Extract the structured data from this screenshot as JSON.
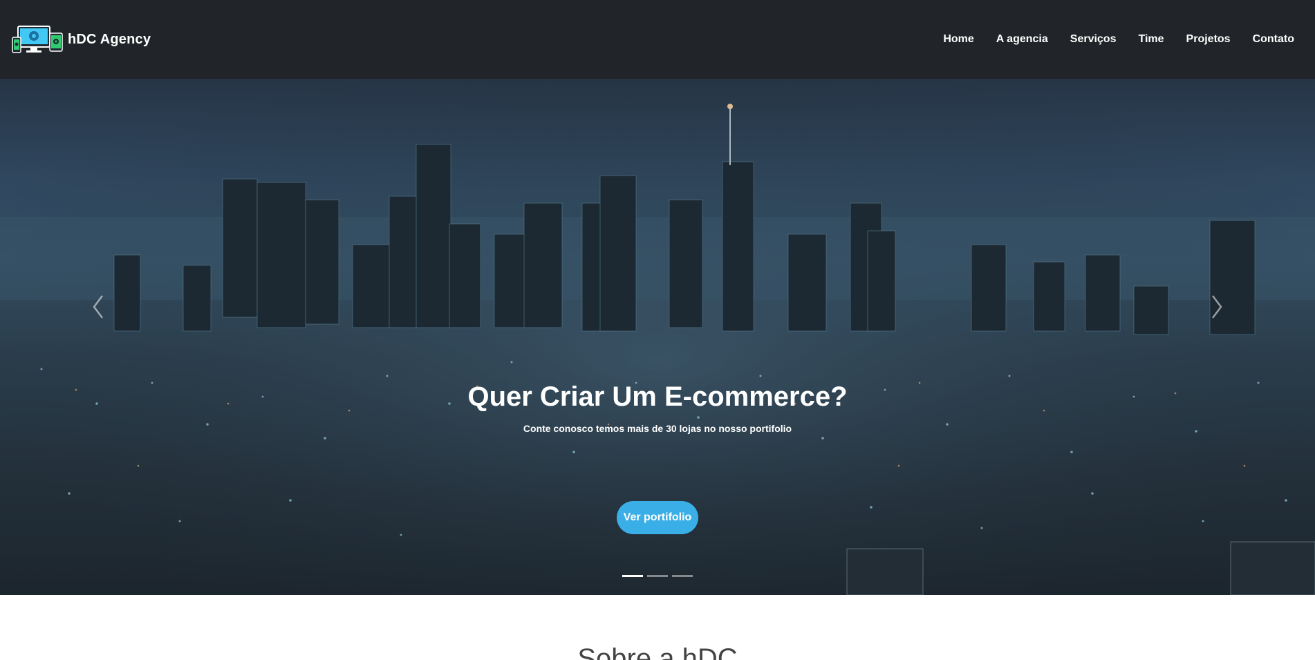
{
  "navbar": {
    "brand": "hDC Agency",
    "logo_icon": "devices-logo-icon",
    "links": [
      "Home",
      "A agencia",
      "Serviços",
      "Time",
      "Projetos",
      "Contato"
    ]
  },
  "hero": {
    "title": "Quer Criar Um E-commerce?",
    "subtitle": "Conte conosco temos mais de 30 lojas no nosso portifolio",
    "button_label": "Ver portifolio",
    "button_color": "#3aaee6",
    "slide_count": 3,
    "active_slide": 1
  },
  "about": {
    "title": "Sobre a hDC"
  },
  "colors": {
    "navbar_bg": "#212529",
    "accent": "#3aaee6"
  }
}
